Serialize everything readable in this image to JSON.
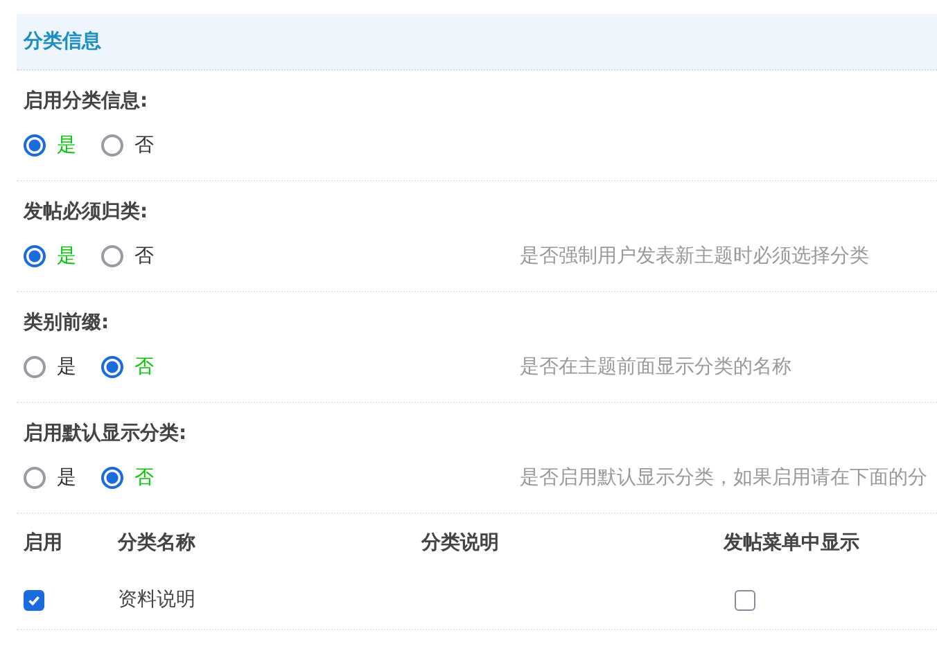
{
  "section_title": "分类信息",
  "settings": [
    {
      "label": "启用分类信息:",
      "options": [
        {
          "label": "是",
          "selected": true
        },
        {
          "label": "否",
          "selected": false
        }
      ]
    },
    {
      "label": "发帖必须归类:",
      "options": [
        {
          "label": "是",
          "selected": true
        },
        {
          "label": "否",
          "selected": false
        }
      ],
      "description": "是否强制用户发表新主题时必须选择分类"
    },
    {
      "label": "类别前缀:",
      "options": [
        {
          "label": "是",
          "selected": false
        },
        {
          "label": "否",
          "selected": true
        }
      ],
      "description": "是否在主题前面显示分类的名称"
    },
    {
      "label": "启用默认显示分类:",
      "options": [
        {
          "label": "是",
          "selected": false
        },
        {
          "label": "否",
          "selected": true
        }
      ],
      "description": "是否启用默认显示分类，如果启用请在下面的分"
    }
  ],
  "table": {
    "columns": [
      "启用",
      "分类名称",
      "分类说明",
      "发帖菜单中显示"
    ],
    "rows": [
      {
        "enabled": true,
        "name": "资料说明",
        "show_in_menu": false
      }
    ]
  }
}
